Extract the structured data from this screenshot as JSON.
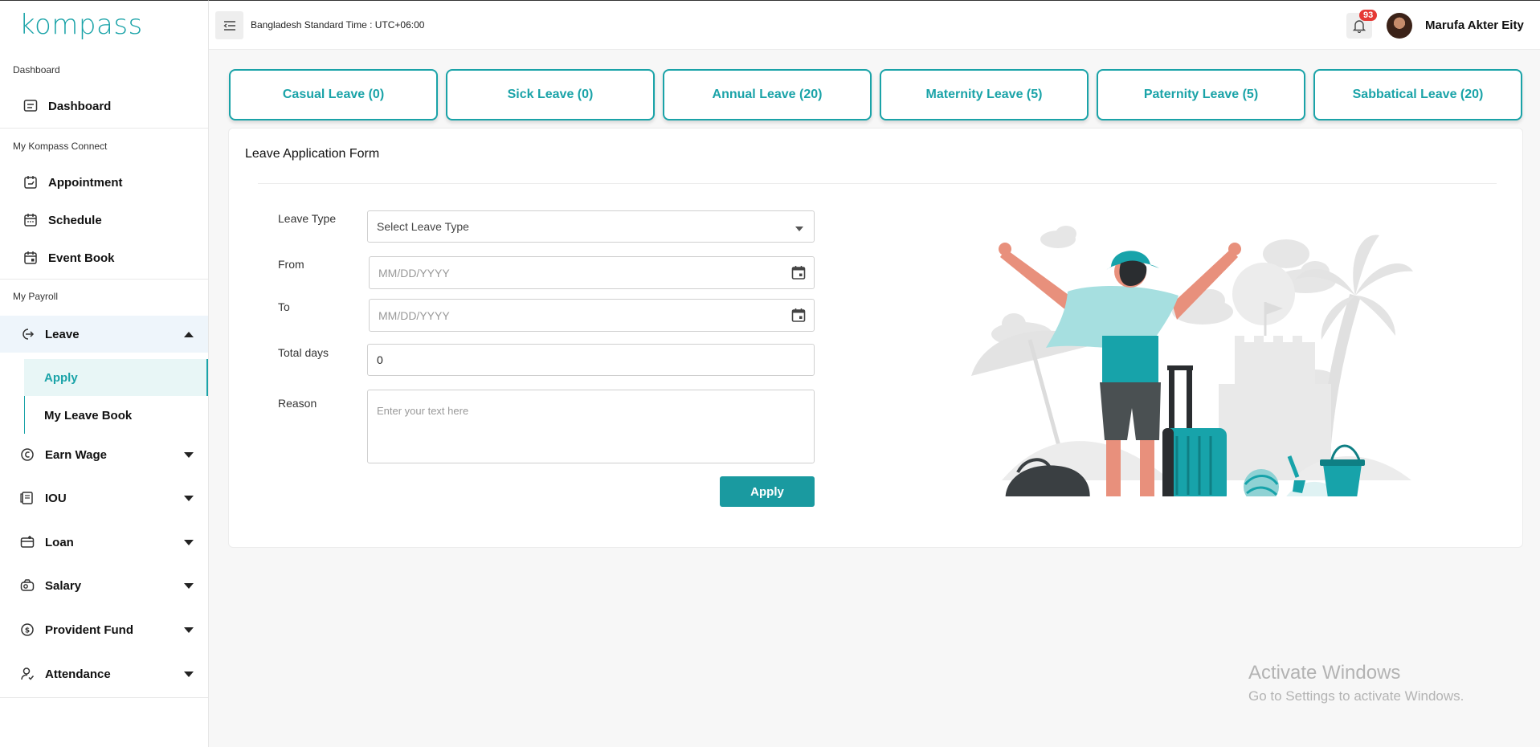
{
  "app": {
    "logo": "kompass"
  },
  "header": {
    "timezone": "Bangladesh Standard Time : UTC+06:00",
    "notification_count": "93",
    "user_name": "Marufa Akter Eity"
  },
  "sidebar": {
    "sections": [
      "Dashboard",
      "My Kompass Connect",
      "My Payroll"
    ],
    "items": {
      "dashboard": "Dashboard",
      "appointment": "Appointment",
      "schedule": "Schedule",
      "event_book": "Event Book",
      "leave": "Leave",
      "apply": "Apply",
      "my_leave_book": "My Leave Book",
      "earn_wage": "Earn Wage",
      "iou": "IOU",
      "loan": "Loan",
      "salary": "Salary",
      "provident_fund": "Provident Fund",
      "attendance": "Attendance"
    }
  },
  "leave_cards": [
    "Casual Leave (0)",
    "Sick Leave (0)",
    "Annual Leave (20)",
    "Maternity Leave (5)",
    "Paternity Leave (5)",
    "Sabbatical Leave (20)"
  ],
  "form": {
    "title": "Leave Application Form",
    "leave_type_label": "Leave Type",
    "leave_type_placeholder": "Select Leave Type",
    "from_label": "From",
    "from_placeholder": "MM/DD/YYYY",
    "to_label": "To",
    "to_placeholder": "MM/DD/YYYY",
    "total_days_label": "Total days",
    "total_days_value": "0",
    "reason_label": "Reason",
    "reason_placeholder": "Enter your text here",
    "apply_label": "Apply"
  },
  "watermark": {
    "line1": "Activate Windows",
    "line2": "Go to Settings to activate Windows."
  },
  "colors": {
    "accent": "#1aa3a8",
    "active_bg": "#eef5fb",
    "apply_bg": "#e8f6f6"
  }
}
